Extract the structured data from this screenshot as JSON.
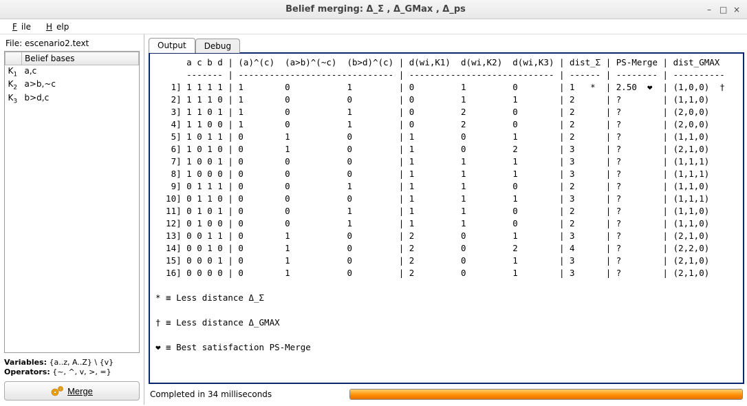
{
  "window": {
    "title": "Belief merging: Δ_Σ , Δ_GMax , Δ_ps",
    "min": "–",
    "max": "□",
    "close": "×"
  },
  "menu": {
    "file": "File",
    "help": "Help"
  },
  "sidebar": {
    "file_label": "File: escenario2.text",
    "bb_header": "Belief bases",
    "bases": [
      {
        "k": "K",
        "idx": "1",
        "content": "a,c"
      },
      {
        "k": "K",
        "idx": "2",
        "content": "a>b,~c"
      },
      {
        "k": "K",
        "idx": "3",
        "content": "b>d,c"
      }
    ],
    "vars_label": "Variables:",
    "vars_value": " {a..z, A..Z} \\ {v}",
    "ops_label": "Operators:",
    "ops_value": " {~, ^, v, >, =}",
    "merge_label": "Merge"
  },
  "tabs": {
    "output": "Output",
    "debug": "Debug"
  },
  "output_text": "      a c b d | (a)^(c)  (a>b)^(~c)  (b>d)^(c) | d(wi,K1)  d(wi,K2)  d(wi,K3) | dist_Σ | PS-Merge | dist_GMAX\n      ------- | ------------------------------ | ---------------------------- | ------ | -------- | ----------\n   1] 1 1 1 1 | 1        0           1         | 0         1         0        | 1   *  | 2.50  ❤  | (1,0,0)  †\n   2] 1 1 1 0 | 1        0           0         | 0         1         1        | 2      | ?        | (1,1,0)\n   3] 1 1 0 1 | 1        0           1         | 0         2         0        | 2      | ?        | (2,0,0)\n   4] 1 1 0 0 | 1        0           1         | 0         2         0        | 2      | ?        | (2,0,0)\n   5] 1 0 1 1 | 0        1           0         | 1         0         1        | 2      | ?        | (1,1,0)\n   6] 1 0 1 0 | 0        1           0         | 1         0         2        | 3      | ?        | (2,1,0)\n   7] 1 0 0 1 | 0        0           0         | 1         1         1        | 3      | ?        | (1,1,1)\n   8] 1 0 0 0 | 0        0           0         | 1         1         1        | 3      | ?        | (1,1,1)\n   9] 0 1 1 1 | 0        0           1         | 1         1         0        | 2      | ?        | (1,1,0)\n  10] 0 1 1 0 | 0        0           0         | 1         1         1        | 3      | ?        | (1,1,1)\n  11] 0 1 0 1 | 0        0           1         | 1         1         0        | 2      | ?        | (1,1,0)\n  12] 0 1 0 0 | 0        0           1         | 1         1         0        | 2      | ?        | (1,1,0)\n  13] 0 0 1 1 | 0        1           0         | 2         0         1        | 3      | ?        | (2,1,0)\n  14] 0 0 1 0 | 0        1           0         | 2         0         2        | 4      | ?        | (2,2,0)\n  15] 0 0 0 1 | 0        1           0         | 2         0         1        | 3      | ?        | (2,1,0)\n  16] 0 0 0 0 | 0        1           0         | 2         0         1        | 3      | ?        | (2,1,0)\n\n* ≡ Less distance Δ_Σ\n\n† ≡ Less distance Δ_GMAX\n\n❤ ≡ Best satisfaction PS-Merge",
  "status": {
    "msg": "Completed in 34 milliseconds"
  },
  "chart_data": {
    "type": "table",
    "columns": [
      "idx",
      "a",
      "c",
      "b",
      "d",
      "(a)^(c)",
      "(a>b)^(~c)",
      "(b>d)^(c)",
      "d(wi,K1)",
      "d(wi,K2)",
      "d(wi,K3)",
      "dist_Σ",
      "dist_Σ_mark",
      "PS-Merge",
      "PS-Merge_mark",
      "dist_GMAX",
      "dist_GMAX_mark"
    ],
    "rows": [
      [
        1,
        1,
        1,
        1,
        1,
        1,
        0,
        1,
        0,
        1,
        0,
        1,
        "*",
        "2.50",
        "❤",
        "(1,0,0)",
        "†"
      ],
      [
        2,
        1,
        1,
        1,
        0,
        1,
        0,
        0,
        0,
        1,
        1,
        2,
        "",
        "?",
        "",
        "(1,1,0)",
        ""
      ],
      [
        3,
        1,
        1,
        0,
        1,
        1,
        0,
        1,
        0,
        2,
        0,
        2,
        "",
        "?",
        "",
        "(2,0,0)",
        ""
      ],
      [
        4,
        1,
        1,
        0,
        0,
        1,
        0,
        1,
        0,
        2,
        0,
        2,
        "",
        "?",
        "",
        "(2,0,0)",
        ""
      ],
      [
        5,
        1,
        0,
        1,
        1,
        0,
        1,
        0,
        1,
        0,
        1,
        2,
        "",
        "?",
        "",
        "(1,1,0)",
        ""
      ],
      [
        6,
        1,
        0,
        1,
        0,
        0,
        1,
        0,
        1,
        0,
        2,
        3,
        "",
        "?",
        "",
        "(2,1,0)",
        ""
      ],
      [
        7,
        1,
        0,
        0,
        1,
        0,
        0,
        0,
        1,
        1,
        1,
        3,
        "",
        "?",
        "",
        "(1,1,1)",
        ""
      ],
      [
        8,
        1,
        0,
        0,
        0,
        0,
        0,
        0,
        1,
        1,
        1,
        3,
        "",
        "?",
        "",
        "(1,1,1)",
        ""
      ],
      [
        9,
        0,
        1,
        1,
        1,
        0,
        0,
        1,
        1,
        1,
        0,
        2,
        "",
        "?",
        "",
        "(1,1,0)",
        ""
      ],
      [
        10,
        0,
        1,
        1,
        0,
        0,
        0,
        0,
        1,
        1,
        1,
        3,
        "",
        "?",
        "",
        "(1,1,1)",
        ""
      ],
      [
        11,
        0,
        1,
        0,
        1,
        0,
        0,
        1,
        1,
        1,
        0,
        2,
        "",
        "?",
        "",
        "(1,1,0)",
        ""
      ],
      [
        12,
        0,
        1,
        0,
        0,
        0,
        0,
        1,
        1,
        1,
        0,
        2,
        "",
        "?",
        "",
        "(1,1,0)",
        ""
      ],
      [
        13,
        0,
        0,
        1,
        1,
        0,
        1,
        0,
        2,
        0,
        1,
        3,
        "",
        "?",
        "",
        "(2,1,0)",
        ""
      ],
      [
        14,
        0,
        0,
        1,
        0,
        0,
        1,
        0,
        2,
        0,
        2,
        4,
        "",
        "?",
        "",
        "(2,2,0)",
        ""
      ],
      [
        15,
        0,
        0,
        0,
        1,
        0,
        1,
        0,
        2,
        0,
        1,
        3,
        "",
        "?",
        "",
        "(2,1,0)",
        ""
      ],
      [
        16,
        0,
        0,
        0,
        0,
        0,
        1,
        0,
        2,
        0,
        1,
        3,
        "",
        "?",
        "",
        "(2,1,0)",
        ""
      ]
    ],
    "legend": {
      "*": "Less distance Δ_Σ",
      "†": "Less distance Δ_GMAX",
      "❤": "Best satisfaction PS-Merge"
    }
  }
}
